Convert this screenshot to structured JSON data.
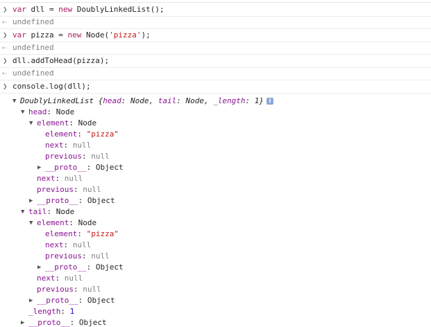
{
  "console": {
    "entries": [
      {
        "input": "var dll = new DoublyLinkedList();",
        "result": "undefined"
      },
      {
        "input": "var pizza = new Node('pizza');",
        "result": "undefined"
      },
      {
        "input": "dll.addToHead(pizza);",
        "result": "undefined"
      },
      {
        "input": "console.log(dll);"
      }
    ],
    "tokens": {
      "var": "var",
      "new": "new",
      "e0_rest_a": " dll = ",
      "e0_rest_b": " DoublyLinkedList();",
      "e1_rest_a": " pizza = ",
      "e1_rest_b": " Node(",
      "e1_str": "'pizza'",
      "e1_rest_c": ");"
    },
    "log_output": {
      "summary_class": "DoublyLinkedList",
      "summary_body_open": " {",
      "summary_k_head": "head",
      "summary_v_head": ": Node, ",
      "summary_k_tail": "tail",
      "summary_v_tail": ": Node, ",
      "summary_k_length": "_length",
      "summary_v_length": ": 1}",
      "info_icon_glyph": "i",
      "head_key": "head",
      "tail_key": "tail",
      "element_key": "element",
      "next_key": "next",
      "previous_key": "previous",
      "proto_key": "__proto__",
      "length_key": "_length",
      "colon_node": ": Node",
      "colon": ": ",
      "colon_object": ": Object",
      "pizza_value": "\"pizza\"",
      "null_value": "null",
      "length_value": "1"
    }
  }
}
